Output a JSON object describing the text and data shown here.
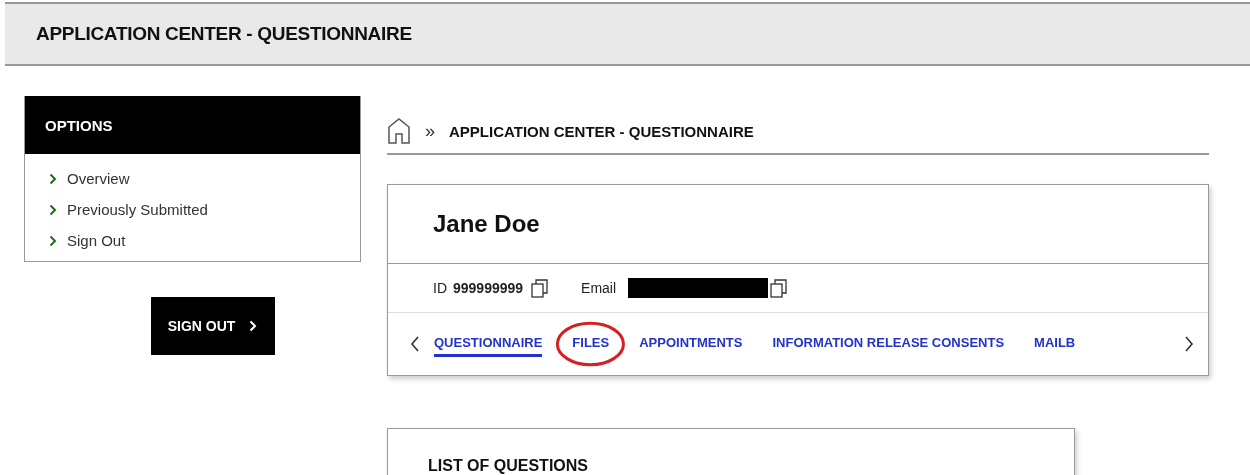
{
  "header": {
    "title": "APPLICATION CENTER - QUESTIONNAIRE"
  },
  "sidebar": {
    "title": "OPTIONS",
    "items": [
      {
        "label": "Overview"
      },
      {
        "label": "Previously Submitted"
      },
      {
        "label": "Sign Out"
      }
    ],
    "sign_out_button": "SIGN OUT"
  },
  "breadcrumb": {
    "separator": "»",
    "current": "APPLICATION CENTER - QUESTIONNAIRE"
  },
  "profile": {
    "name": "Jane Doe",
    "id_label": "ID",
    "id_value": "999999999",
    "email_label": "Email",
    "email_redacted": true,
    "tabs": [
      {
        "label": "QUESTIONNAIRE",
        "selected": true,
        "circled": false
      },
      {
        "label": "FILES",
        "selected": false,
        "circled": true
      },
      {
        "label": "APPOINTMENTS",
        "selected": false,
        "circled": false
      },
      {
        "label": "INFORMATION RELEASE CONSENTS",
        "selected": false,
        "circled": false
      },
      {
        "label": "MAILB",
        "selected": false,
        "circled": false
      }
    ]
  },
  "questions": {
    "title": "LIST OF QUESTIONS"
  }
}
